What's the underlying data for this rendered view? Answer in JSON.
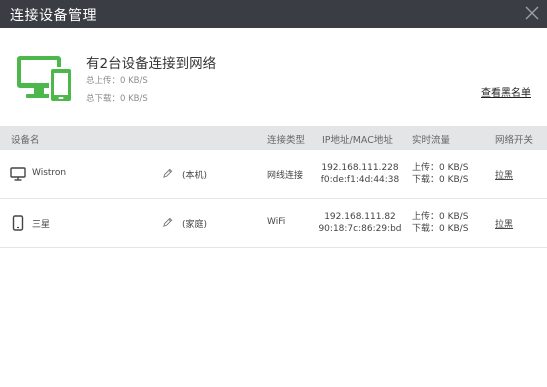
{
  "window": {
    "title": "连接设备管理",
    "close_icon": "close-icon"
  },
  "summary": {
    "headline": "有2台设备连接到网络",
    "upload_rate": "总上传：0 KB/S",
    "download_rate": "总下载：0 KB/S",
    "blacklist_link": "查看黑名单",
    "graphic_icon": "devices-icon",
    "accent_color": "#4cb84c"
  },
  "table": {
    "headers": {
      "device": "设备名",
      "connection_type": "连接类型",
      "address": "IP地址/MAC地址",
      "traffic": "实时流量",
      "switch": "网络开关"
    },
    "rows": [
      {
        "icon": "monitor-icon",
        "name": "Wistron",
        "tag": "(本机)",
        "connection": "网线连接",
        "ip": "192.168.111.228",
        "mac": "f0:de:f1:4d:44:38",
        "upload": "上传：0 KB/S",
        "download": "下载：0 KB/S",
        "action": "拉黑"
      },
      {
        "icon": "phone-icon",
        "name": "三星",
        "tag": "(家庭)",
        "connection": "WiFi",
        "ip": "192.168.111.82",
        "mac": "90:18:7c:86:29:bd",
        "upload": "上传：0 KB/S",
        "download": "下载：0 KB/S",
        "action": "拉黑"
      }
    ]
  }
}
